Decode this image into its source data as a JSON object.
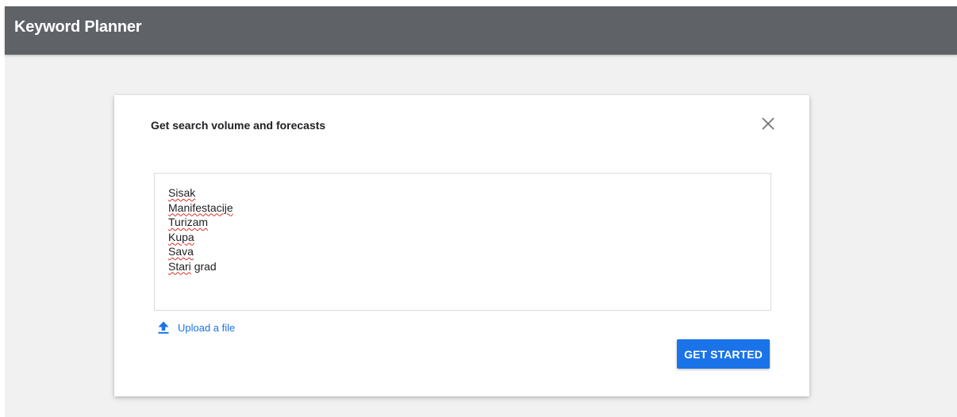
{
  "app_bar": {
    "title": "Keyword Planner"
  },
  "dialog": {
    "title": "Get search volume and forecasts",
    "close_icon": "close-icon",
    "keywords": [
      {
        "text": "Sisak",
        "misspelled": [
          "Sisak"
        ]
      },
      {
        "text": "Manifestacije",
        "misspelled": [
          "Manifestacije"
        ]
      },
      {
        "text": "Turizam",
        "misspelled": [
          "Turizam"
        ]
      },
      {
        "text": "Kupa",
        "misspelled": [
          "Kupa"
        ]
      },
      {
        "text": "Sava",
        "misspelled": [
          "Sava"
        ]
      },
      {
        "text": "Stari grad",
        "misspelled": [
          "Stari"
        ]
      }
    ],
    "upload": {
      "icon": "upload-icon",
      "label": "Upload a file"
    },
    "primary_button": {
      "label": "GET STARTED"
    }
  },
  "colors": {
    "app_bar": "#5f6368",
    "background": "#f1f1f1",
    "accent": "#1a73e8",
    "spellcheck": "#d93025",
    "text": "#202124"
  }
}
